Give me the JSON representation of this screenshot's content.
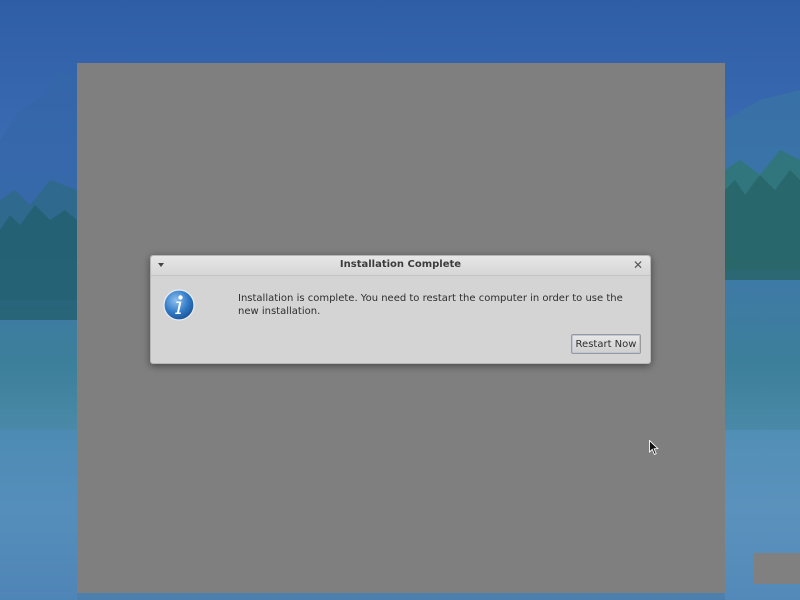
{
  "dialog": {
    "title": "Installation Complete",
    "message": "Installation is complete. You need to restart the computer in order to use the new installation.",
    "restart_label": "Restart Now",
    "close_glyph": "✕",
    "icon": "info-icon"
  },
  "colors": {
    "dialog_bg": "#d4d4d4",
    "backdrop": "#7f7f7f",
    "info_icon": "#2f78c4"
  }
}
